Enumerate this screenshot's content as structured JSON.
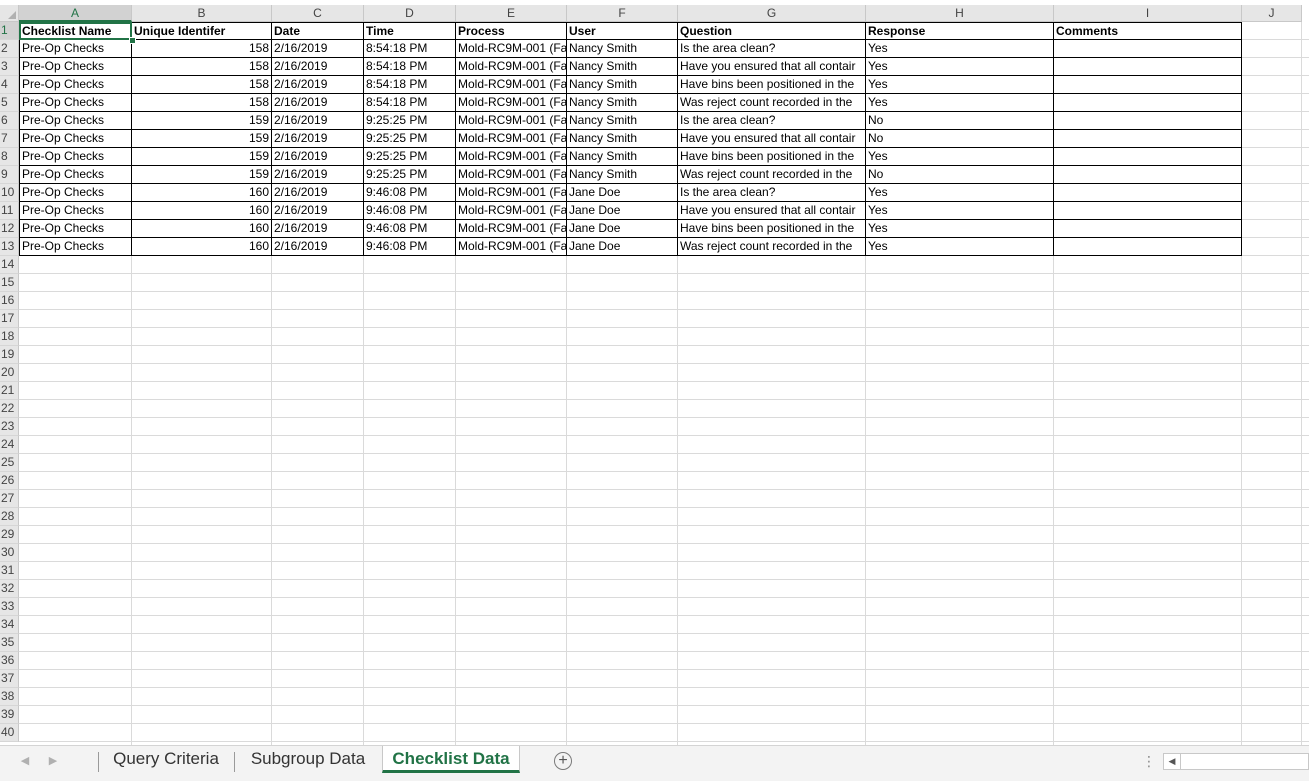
{
  "columns": [
    "A",
    "B",
    "C",
    "D",
    "E",
    "F",
    "G",
    "H",
    "I",
    "J"
  ],
  "active_column": "A",
  "active_row": 1,
  "row_numbers": [
    1,
    2,
    3,
    4,
    5,
    6,
    7,
    8,
    9,
    10,
    11,
    12,
    13,
    14,
    15,
    16,
    17,
    18,
    19,
    20,
    21,
    22,
    23,
    24,
    25,
    26,
    27,
    28,
    29,
    30,
    31,
    32,
    33,
    34,
    35,
    36,
    37,
    38,
    39,
    40
  ],
  "headers": [
    "Checklist Name",
    "Unique Identifer",
    "Date",
    "Time",
    "Process",
    "User",
    "Question",
    "Response",
    "Comments"
  ],
  "rows": [
    [
      "Pre-Op Checks",
      "158",
      "2/16/2019",
      "8:54:18 PM",
      "Mold-RC9M-001 (Fa",
      "Nancy Smith",
      "Is the area clean?",
      "Yes",
      ""
    ],
    [
      "Pre-Op Checks",
      "158",
      "2/16/2019",
      "8:54:18 PM",
      "Mold-RC9M-001 (Fa",
      "Nancy Smith",
      "Have you ensured that all contair",
      "Yes",
      ""
    ],
    [
      "Pre-Op Checks",
      "158",
      "2/16/2019",
      "8:54:18 PM",
      "Mold-RC9M-001 (Fa",
      "Nancy Smith",
      "Have bins been positioned in the",
      "Yes",
      ""
    ],
    [
      "Pre-Op Checks",
      "158",
      "2/16/2019",
      "8:54:18 PM",
      "Mold-RC9M-001 (Fa",
      "Nancy Smith",
      "Was reject count recorded in the",
      "Yes",
      ""
    ],
    [
      "Pre-Op Checks",
      "159",
      "2/16/2019",
      "9:25:25 PM",
      "Mold-RC9M-001 (Fa",
      "Nancy Smith",
      "Is the area clean?",
      "No",
      ""
    ],
    [
      "Pre-Op Checks",
      "159",
      "2/16/2019",
      "9:25:25 PM",
      "Mold-RC9M-001 (Fa",
      "Nancy Smith",
      "Have you ensured that all contair",
      "No",
      ""
    ],
    [
      "Pre-Op Checks",
      "159",
      "2/16/2019",
      "9:25:25 PM",
      "Mold-RC9M-001 (Fa",
      "Nancy Smith",
      "Have bins been positioned in the",
      "Yes",
      ""
    ],
    [
      "Pre-Op Checks",
      "159",
      "2/16/2019",
      "9:25:25 PM",
      "Mold-RC9M-001 (Fa",
      "Nancy Smith",
      "Was reject count recorded in the",
      "No",
      ""
    ],
    [
      "Pre-Op Checks",
      "160",
      "2/16/2019",
      "9:46:08 PM",
      "Mold-RC9M-001 (Fa",
      "Jane Doe",
      "Is the area clean?",
      "Yes",
      ""
    ],
    [
      "Pre-Op Checks",
      "160",
      "2/16/2019",
      "9:46:08 PM",
      "Mold-RC9M-001 (Fa",
      "Jane Doe",
      "Have you ensured that all contair",
      "Yes",
      ""
    ],
    [
      "Pre-Op Checks",
      "160",
      "2/16/2019",
      "9:46:08 PM",
      "Mold-RC9M-001 (Fa",
      "Jane Doe",
      "Have bins been positioned in the",
      "Yes",
      ""
    ],
    [
      "Pre-Op Checks",
      "160",
      "2/16/2019",
      "9:46:08 PM",
      "Mold-RC9M-001 (Fa",
      "Jane Doe",
      "Was reject count recorded in the",
      "Yes",
      ""
    ]
  ],
  "sheet_tabs": [
    {
      "label": "Query Criteria",
      "active": false
    },
    {
      "label": "Subgroup Data",
      "active": false
    },
    {
      "label": "Checklist Data",
      "active": true
    }
  ],
  "icons": {
    "nav_prev": "chevron-left-icon",
    "nav_next": "chevron-right-icon",
    "add_sheet": "plus-circle-icon",
    "scroll_left": "chevron-left-icon"
  },
  "colors": {
    "accent": "#217346",
    "header_bg": "#e6e6e6",
    "gridline": "#dadada"
  }
}
